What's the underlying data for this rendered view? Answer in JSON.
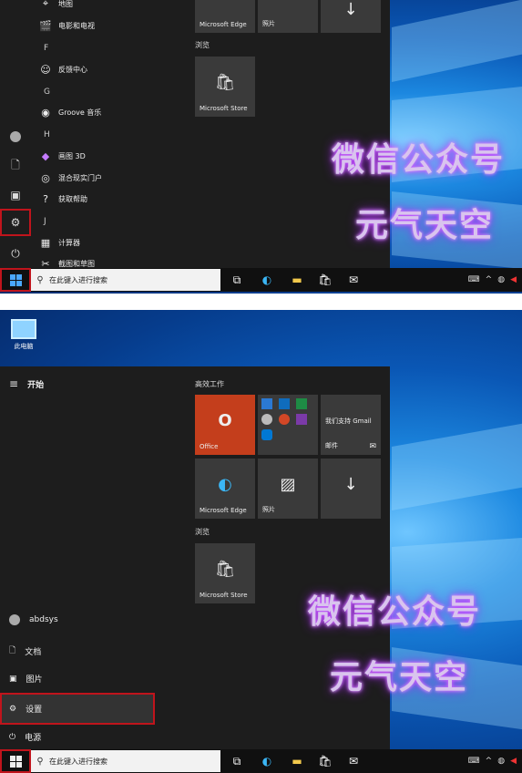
{
  "watermark": {
    "line1": "微信公众号",
    "line2": "元气天空"
  },
  "taskbar": {
    "search_placeholder": "在此键入进行搜索"
  },
  "top_panel": {
    "apps": [
      {
        "label": "地图",
        "icon": "map-pin-icon"
      },
      {
        "label": "电影和电视",
        "icon": "film-icon"
      },
      {
        "letter": "F"
      },
      {
        "label": "反馈中心",
        "icon": "feedback-icon"
      },
      {
        "letter": "G"
      },
      {
        "label": "Groove 音乐",
        "icon": "groove-icon"
      },
      {
        "letter": "H"
      },
      {
        "label": "画图 3D",
        "icon": "paint3d-icon"
      },
      {
        "label": "混合现实门户",
        "icon": "mixed-reality-icon"
      },
      {
        "label": "获取帮助",
        "icon": "help-icon"
      },
      {
        "letter": "J"
      },
      {
        "label": "计算器",
        "icon": "calculator-icon"
      },
      {
        "label": "截图和草图",
        "icon": "snip-icon"
      }
    ],
    "tiles": {
      "edge": "Microsoft Edge",
      "photos": "照片",
      "group": "浏览",
      "store": "Microsoft Store"
    }
  },
  "bottom_panel": {
    "desktop_icon_label": "此电脑",
    "start_header": "开始",
    "group1": "高效工作",
    "tiles": {
      "office": "Office",
      "mail_top": "我们支持 Gmail",
      "mail": "邮件",
      "edge": "Microsoft Edge",
      "photos": "照片",
      "group2": "浏览",
      "store": "Microsoft Store"
    },
    "menu": {
      "user": "abdsys",
      "documents": "文档",
      "pictures": "图片",
      "settings": "设置",
      "power": "电源"
    }
  },
  "colors": {
    "highlight_box": "#c0141c",
    "office_tile": "#c43e1c",
    "taskbar": "#101010",
    "menu_bg": "#1d1d1d"
  }
}
